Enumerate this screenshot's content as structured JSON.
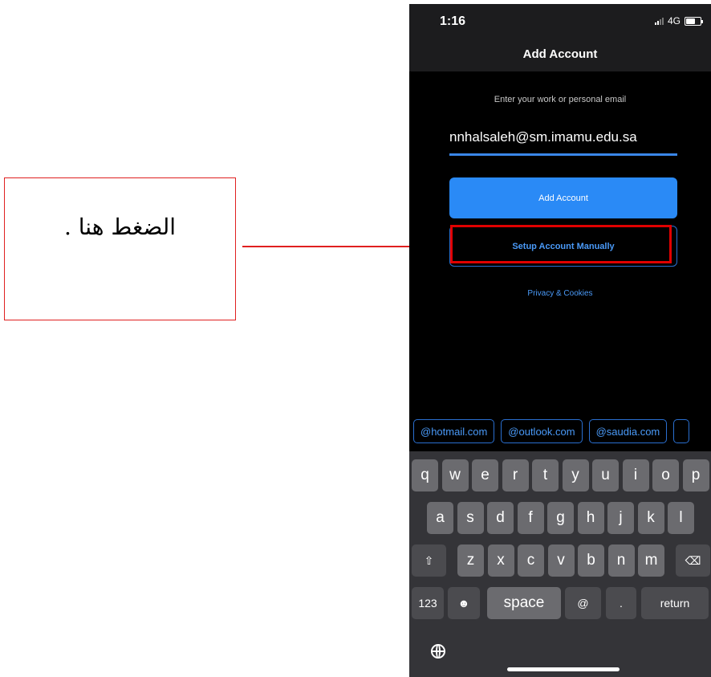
{
  "annotation": {
    "text": "الضغط هنا ."
  },
  "status_bar": {
    "time": "1:16",
    "network": "4G",
    "signal_icon": "signal-bars-icon",
    "battery_icon": "battery-icon"
  },
  "nav": {
    "title": "Add Account"
  },
  "form": {
    "hint": "Enter your work or personal email",
    "email_value": "nnhalsaleh@sm.imamu.edu.sa",
    "add_button": "Add Account",
    "setup_button": "Setup Account Manually",
    "privacy_link": "Privacy & Cookies"
  },
  "suggestions": [
    "@hotmail.com",
    "@outlook.com",
    "@saudia.com"
  ],
  "keyboard": {
    "row1": [
      "q",
      "w",
      "e",
      "r",
      "t",
      "y",
      "u",
      "i",
      "o",
      "p"
    ],
    "row2": [
      "a",
      "s",
      "d",
      "f",
      "g",
      "h",
      "j",
      "k",
      "l"
    ],
    "row3": [
      "z",
      "x",
      "c",
      "v",
      "b",
      "n",
      "m"
    ],
    "numbers_key": "123",
    "emoji_icon": "☻",
    "space_key": "space",
    "at_key": "@",
    "period_key": ".",
    "return_key": "return",
    "shift_icon": "⇧",
    "delete_icon": "⌫"
  },
  "colors": {
    "accent": "#2a8af6",
    "annotation": "#e02020",
    "highlight": "#e00000",
    "background": "#000000"
  }
}
